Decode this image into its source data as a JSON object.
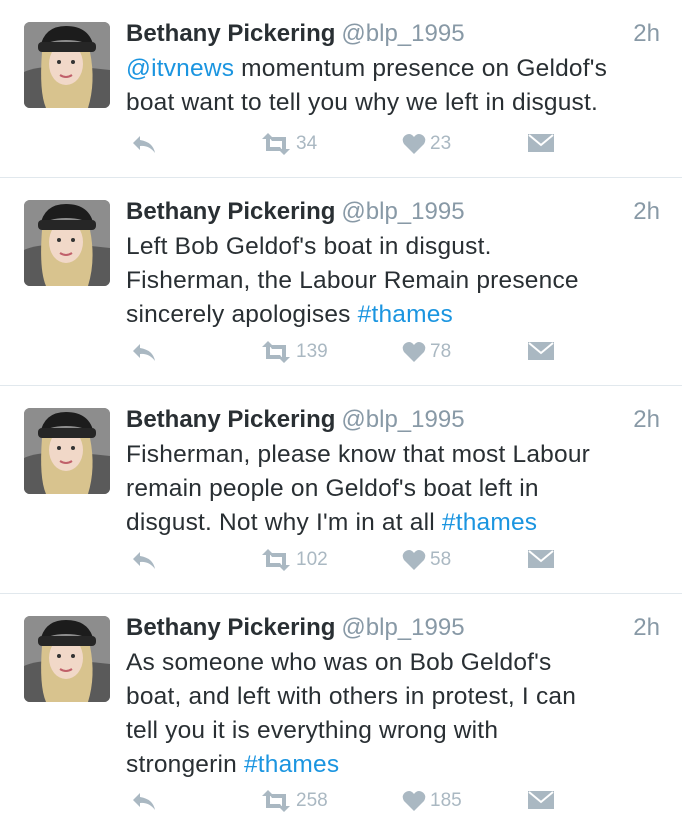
{
  "tweets": [
    {
      "name": "Bethany Pickering",
      "handle": "@blp_1995",
      "time": "2h",
      "lines": [
        [
          {
            "t": "@itvnews",
            "link": true
          },
          {
            "t": " momentum presence on Geldof's"
          }
        ],
        [
          {
            "t": "boat want to tell you why we left in disgust."
          }
        ]
      ],
      "retweets": "34",
      "likes": "23"
    },
    {
      "name": "Bethany Pickering",
      "handle": "@blp_1995",
      "time": "2h",
      "lines": [
        [
          {
            "t": "Left Bob Geldof's boat in disgust."
          }
        ],
        [
          {
            "t": "Fisherman, the Labour Remain presence"
          }
        ],
        [
          {
            "t": "sincerely apologises "
          },
          {
            "t": "#thames",
            "link": true
          }
        ]
      ],
      "retweets": "139",
      "likes": "78"
    },
    {
      "name": "Bethany Pickering",
      "handle": "@blp_1995",
      "time": "2h",
      "lines": [
        [
          {
            "t": "Fisherman, please know that most Labour"
          }
        ],
        [
          {
            "t": "remain people on Geldof's boat left in"
          }
        ],
        [
          {
            "t": "disgust. Not why I'm in at all "
          },
          {
            "t": "#thames",
            "link": true
          }
        ]
      ],
      "retweets": "102",
      "likes": "58"
    },
    {
      "name": "Bethany Pickering",
      "handle": "@blp_1995",
      "time": "2h",
      "lines": [
        [
          {
            "t": "As someone who was on Bob Geldof's"
          }
        ],
        [
          {
            "t": "boat, and left with others in protest, I can"
          }
        ],
        [
          {
            "t": "tell you it is everything wrong with"
          }
        ],
        [
          {
            "t": "strongerin "
          },
          {
            "t": "#thames",
            "link": true
          }
        ]
      ],
      "retweets": "258",
      "likes": "185"
    }
  ],
  "colors": {
    "link": "#1b95e0",
    "meta": "#8899a6",
    "action": "#aab8c2",
    "divider": "#e1e8ed"
  },
  "icons": {
    "reply": "reply-icon",
    "retweet": "retweet-icon",
    "like": "heart-icon",
    "message": "envelope-icon"
  }
}
